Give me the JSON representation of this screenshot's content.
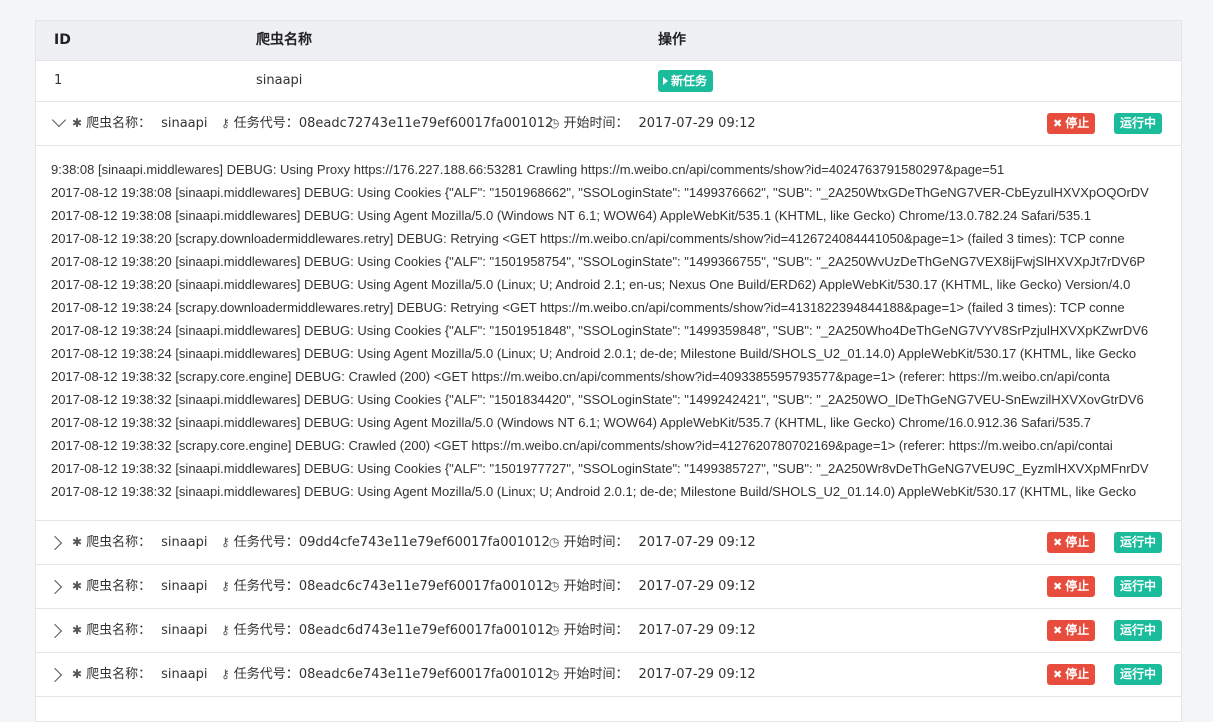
{
  "table": {
    "headers": {
      "id": "ID",
      "name": "爬虫名称",
      "op": "操作"
    },
    "row": {
      "id": "1",
      "name": "sinaapi",
      "new_task_label": "新任务"
    }
  },
  "labels": {
    "spider_name": "爬虫名称：",
    "task_id": "任务代号：",
    "start_time": "开始时间：",
    "stop": "停止",
    "running": "运行中"
  },
  "jobs": [
    {
      "spider": "sinaapi",
      "task_id": "08eadc72743e11e79ef60017fa001012",
      "start_time": "2017-07-29 09:12",
      "expanded": true
    },
    {
      "spider": "sinaapi",
      "task_id": "09dd4cfe743e11e79ef60017fa001012",
      "start_time": "2017-07-29 09:12",
      "expanded": false
    },
    {
      "spider": "sinaapi",
      "task_id": "08eadc6c743e11e79ef60017fa001012",
      "start_time": "2017-07-29 09:12",
      "expanded": false
    },
    {
      "spider": "sinaapi",
      "task_id": "08eadc6d743e11e79ef60017fa001012",
      "start_time": "2017-07-29 09:12",
      "expanded": false
    },
    {
      "spider": "sinaapi",
      "task_id": "08eadc6e743e11e79ef60017fa001012",
      "start_time": "2017-07-29 09:12",
      "expanded": false
    }
  ],
  "log_lines": [
    "9:38:08 [sinaapi.middlewares] DEBUG: Using Proxy https://176.227.188.66:53281 Crawling https://m.weibo.cn/api/comments/show?id=4024763791580297&page=51",
    "2017-08-12 19:38:08 [sinaapi.middlewares] DEBUG: Using Cookies {\"ALF\": \"1501968662\", \"SSOLoginState\": \"1499376662\", \"SUB\": \"_2A250WtxGDeThGeNG7VER-CbEyzulHXVXpOQOrDV",
    "2017-08-12 19:38:08 [sinaapi.middlewares] DEBUG: Using Agent Mozilla/5.0 (Windows NT 6.1; WOW64) AppleWebKit/535.1 (KHTML, like Gecko) Chrome/13.0.782.24 Safari/535.1",
    "2017-08-12 19:38:20 [scrapy.downloadermiddlewares.retry] DEBUG: Retrying <GET https://m.weibo.cn/api/comments/show?id=4126724084441050&page=1> (failed 3 times): TCP conne",
    "2017-08-12 19:38:20 [sinaapi.middlewares] DEBUG: Using Cookies {\"ALF\": \"1501958754\", \"SSOLoginState\": \"1499366755\", \"SUB\": \"_2A250WvUzDeThGeNG7VEX8ijFwjSlHXVXpJt7rDV6P",
    "2017-08-12 19:38:20 [sinaapi.middlewares] DEBUG: Using Agent Mozilla/5.0 (Linux; U; Android 2.1; en-us; Nexus One Build/ERD62) AppleWebKit/530.17 (KHTML, like Gecko) Version/4.0",
    "2017-08-12 19:38:24 [scrapy.downloadermiddlewares.retry] DEBUG: Retrying <GET https://m.weibo.cn/api/comments/show?id=4131822394844188&page=1> (failed 3 times): TCP conne",
    "2017-08-12 19:38:24 [sinaapi.middlewares] DEBUG: Using Cookies {\"ALF\": \"1501951848\", \"SSOLoginState\": \"1499359848\", \"SUB\": \"_2A250Who4DeThGeNG7VYV8SrPzjulHXVXpKZwrDV6",
    "2017-08-12 19:38:24 [sinaapi.middlewares] DEBUG: Using Agent Mozilla/5.0 (Linux; U; Android 2.0.1; de-de; Milestone Build/SHOLS_U2_01.14.0) AppleWebKit/530.17 (KHTML, like Gecko",
    "2017-08-12 19:38:32 [scrapy.core.engine] DEBUG: Crawled (200) <GET https://m.weibo.cn/api/comments/show?id=4093385595793577&page=1> (referer: https://m.weibo.cn/api/conta",
    "2017-08-12 19:38:32 [sinaapi.middlewares] DEBUG: Using Cookies {\"ALF\": \"1501834420\", \"SSOLoginState\": \"1499242421\", \"SUB\": \"_2A250WO_lDeThGeNG7VEU-SnEwzilHXVXovGtrDV6",
    "2017-08-12 19:38:32 [sinaapi.middlewares] DEBUG: Using Agent Mozilla/5.0 (Windows NT 6.1; WOW64) AppleWebKit/535.7 (KHTML, like Gecko) Chrome/16.0.912.36 Safari/535.7",
    "2017-08-12 19:38:32 [scrapy.core.engine] DEBUG: Crawled (200) <GET https://m.weibo.cn/api/comments/show?id=4127620780702169&page=1> (referer: https://m.weibo.cn/api/contai",
    "2017-08-12 19:38:32 [sinaapi.middlewares] DEBUG: Using Cookies {\"ALF\": \"1501977727\", \"SSOLoginState\": \"1499385727\", \"SUB\": \"_2A250Wr8vDeThGeNG7VEU9C_EyzmlHXVXpMFnrDV",
    "2017-08-12 19:38:32 [sinaapi.middlewares] DEBUG: Using Agent Mozilla/5.0 (Linux; U; Android 2.0.1; de-de; Milestone Build/SHOLS_U2_01.14.0) AppleWebKit/530.17 (KHTML, like Gecko"
  ],
  "colors": {
    "accent": "#1abc9c",
    "danger": "#e74c3c"
  },
  "icons": {
    "spider": "bug-icon",
    "task": "key-icon",
    "time": "clock-icon",
    "expand": "chevron-icon"
  }
}
